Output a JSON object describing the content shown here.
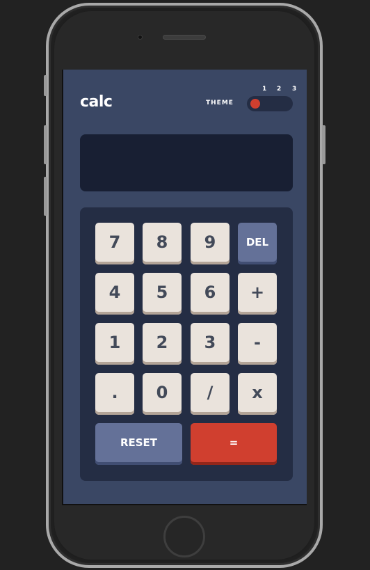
{
  "header": {
    "logo": "calc",
    "theme_label": "THEME",
    "theme_options": [
      "1",
      "2",
      "3"
    ],
    "active_theme": "1"
  },
  "display": {
    "value": ""
  },
  "keypad": {
    "keys": [
      {
        "label": "7",
        "style": "number"
      },
      {
        "label": "8",
        "style": "number"
      },
      {
        "label": "9",
        "style": "number"
      },
      {
        "label": "DEL",
        "style": "function"
      },
      {
        "label": "4",
        "style": "number"
      },
      {
        "label": "5",
        "style": "number"
      },
      {
        "label": "6",
        "style": "number"
      },
      {
        "label": "+",
        "style": "number"
      },
      {
        "label": "1",
        "style": "number"
      },
      {
        "label": "2",
        "style": "number"
      },
      {
        "label": "3",
        "style": "number"
      },
      {
        "label": "-",
        "style": "number"
      },
      {
        "label": ".",
        "style": "number"
      },
      {
        "label": "0",
        "style": "number"
      },
      {
        "label": "/",
        "style": "number"
      },
      {
        "label": "x",
        "style": "number"
      },
      {
        "label": "RESET",
        "style": "function"
      },
      {
        "label": "=",
        "style": "accent"
      }
    ]
  },
  "colors": {
    "background": "#3a4764",
    "display_bg": "#181f33",
    "keypad_bg": "#242d44",
    "key_bg": "#eae3dc",
    "key_text": "#434a59",
    "function_key_bg": "#647198",
    "accent_key_bg": "#d03f2f"
  }
}
